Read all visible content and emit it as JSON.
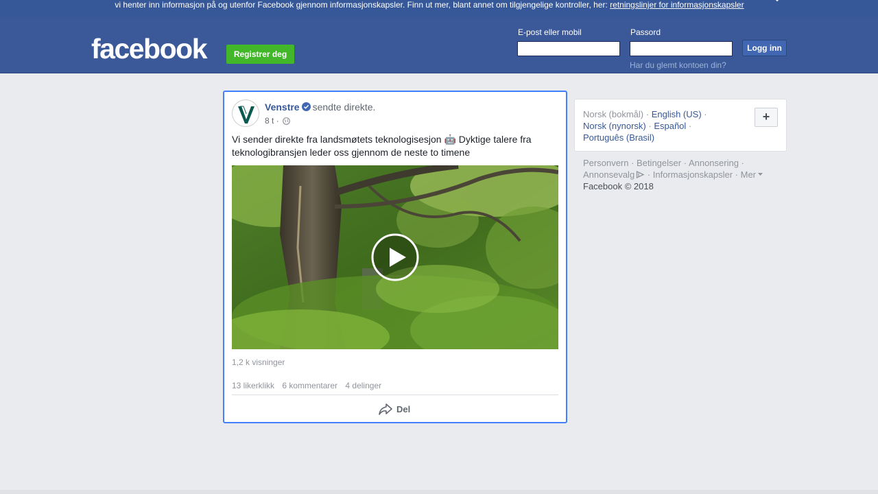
{
  "cookie_banner": {
    "text": "vi henter inn informasjon på og utenfor Facebook gjennom informasjonskapsler. Finn ut mer, blant annet om tilgjengelige kontroller, her:",
    "link": "retningslinjer for informasjonskapsler"
  },
  "header": {
    "logo": "facebook",
    "register_label": "Registrer deg",
    "email_label": "E-post eller mobil",
    "password_label": "Passord",
    "login_label": "Logg inn",
    "forgot_label": "Har du glemt kontoen din?"
  },
  "post": {
    "author": "Venstre",
    "action": "sendte direkte.",
    "time": "8 t",
    "separator": "·",
    "text": "Vi sender direkte fra landsmøtets teknologisesjon 🤖 Dyktige talere fra teknologibransjen leder oss gjennom de neste to timene",
    "views": "1,2 k visninger",
    "likes": "13 likerklikk",
    "comments": "6 kommentarer",
    "shares": "4 delinger",
    "share_label": "Del"
  },
  "languages": {
    "current": "Norsk (bokmål)",
    "items": [
      "English (US)",
      "Norsk (nynorsk)",
      "Español",
      "Português (Brasil)"
    ],
    "plus": "+"
  },
  "footer": {
    "links": [
      "Personvern",
      "Betingelser",
      "Annonsering",
      "Annonsevalg",
      "Informasjonskapsler",
      "Mer"
    ],
    "copyright": "Facebook © 2018"
  },
  "colors": {
    "brand_blue": "#3b5998",
    "banner_blue": "#365899",
    "register_green": "#42b72a",
    "focus_border": "#4080ff"
  },
  "icons": [
    "close-icon",
    "verified-icon",
    "globe-icon",
    "play-icon",
    "share-icon",
    "ad-choices-icon",
    "caret-down-icon"
  ]
}
